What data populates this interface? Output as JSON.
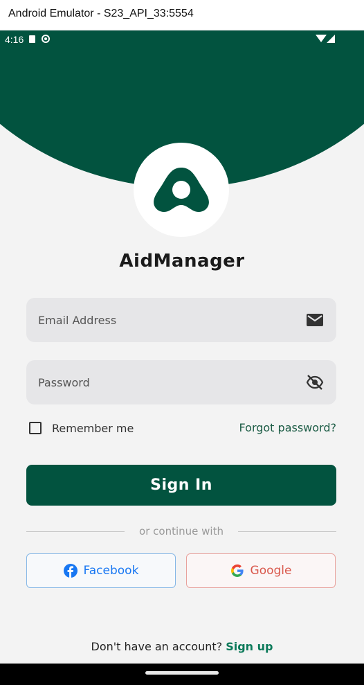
{
  "window": {
    "title": "Android Emulator - S23_API_33:5554"
  },
  "status_bar": {
    "time": "4:16"
  },
  "app": {
    "name": "AidManager"
  },
  "form": {
    "email_placeholder": "Email Address",
    "password_placeholder": "Password",
    "remember_label": "Remember me",
    "forgot_label": "Forgot password?",
    "signin_label": "Sign In"
  },
  "divider": {
    "text": "or continue with"
  },
  "social": {
    "facebook_label": "Facebook",
    "google_label": "Google"
  },
  "signup": {
    "prompt": "Don't have an account? ",
    "link_label": "Sign up"
  },
  "colors": {
    "brand": "#02533f",
    "background": "#f3f3f3",
    "field": "#e6e6e8",
    "facebook": "#1877f2",
    "google": "#d9584c",
    "link": "#0c7a5a"
  },
  "icons": [
    "mail-icon",
    "eye-off-icon",
    "facebook-icon",
    "google-icon",
    "wifi-icon",
    "signal-icon"
  ]
}
